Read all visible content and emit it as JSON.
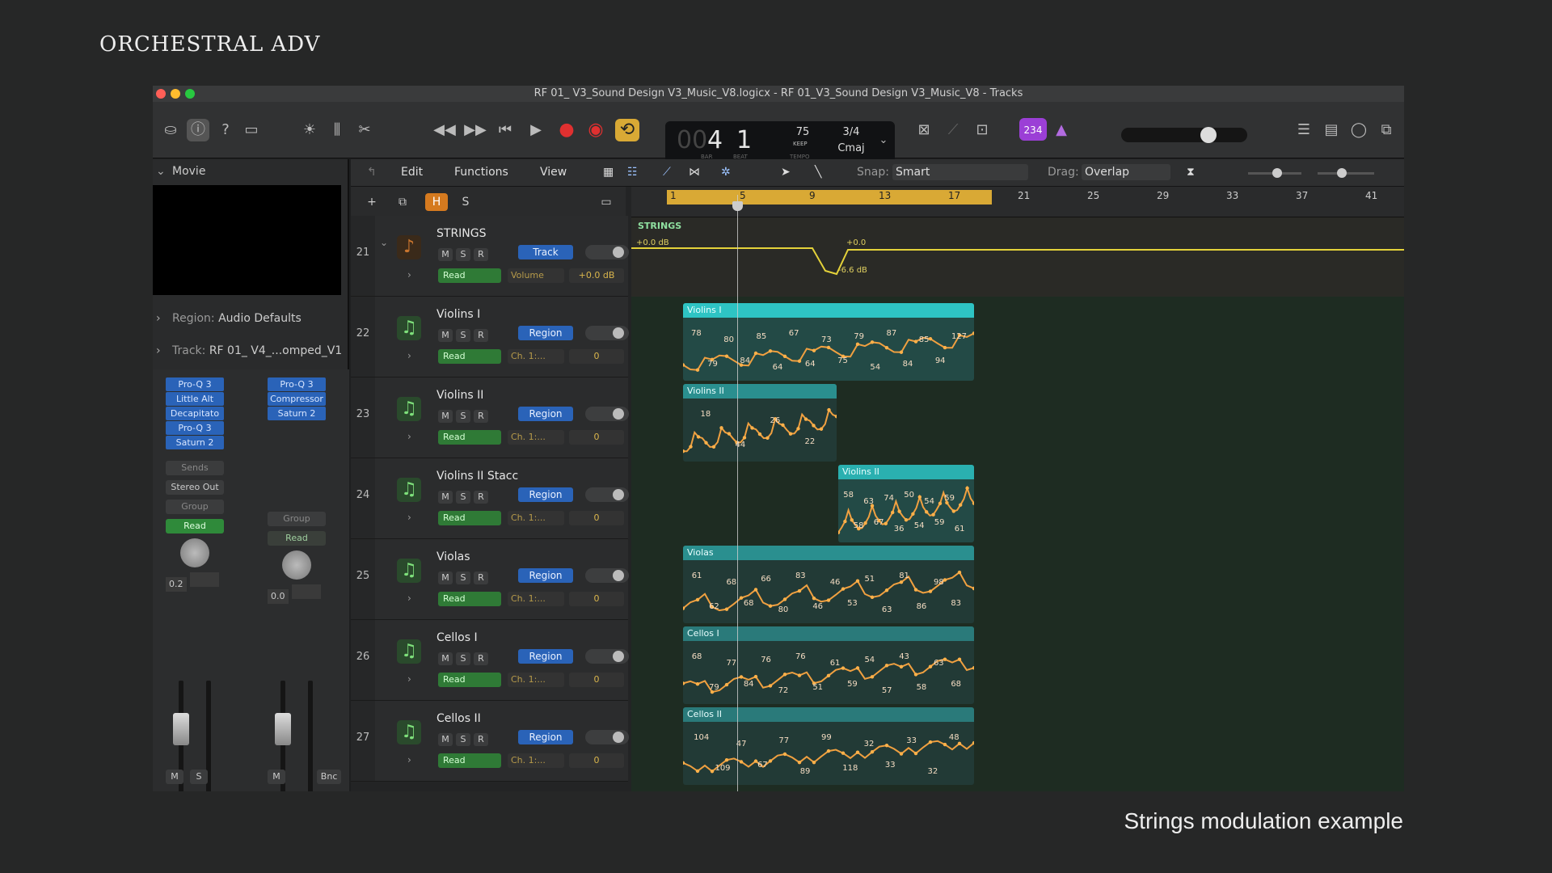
{
  "slide": {
    "title": "ORCHESTRAL ADV",
    "caption": "Strings modulation example"
  },
  "window": {
    "title": "RF 01_ V3_Sound Design V3_Music_V8.logicx - RF 01_V3_Sound Design V3_Music_V8 - Tracks"
  },
  "transport": {
    "bar": "4",
    "beat": "1",
    "bar_label": "BAR",
    "beat_label": "BEAT",
    "tempo": "75",
    "tempo_keep": "KEEP",
    "tempo_label": "TEMPO",
    "signature": "3/4",
    "key": "Cmaj",
    "count_in": "234",
    "accent_color": "#9b3fd6",
    "cycle_color": "#d9a935",
    "record_color": "#e03030"
  },
  "inspector": {
    "movie_label": "Movie",
    "region_label": "Region:",
    "region_value": "Audio Defaults",
    "track_label": "Track:",
    "track_value": "RF 01_ V4_...omped_V1",
    "strip1": {
      "plugins": [
        "Pro-Q 3",
        "Little Alt",
        "Decapitato",
        "Pro-Q 3",
        "Saturn 2"
      ],
      "sends": "Sends",
      "output": "Stereo Out",
      "group": "Group",
      "automation": "Read",
      "pan": "0.2",
      "m": "M",
      "s": "S"
    },
    "strip2": {
      "plugins": [
        "Pro-Q 3",
        "Compressor",
        "Saturn 2"
      ],
      "group": "Group",
      "automation": "Read",
      "pan": "0.0",
      "m": "M",
      "bnc": "Bnc"
    }
  },
  "edit_menu": {
    "edit": "Edit",
    "functions": "Functions",
    "view": "View",
    "snap_label": "Snap:",
    "snap_value": "Smart",
    "drag_label": "Drag:",
    "drag_value": "Overlap"
  },
  "header_buttons": {
    "plus": "+",
    "h": "H",
    "s": "S"
  },
  "tracks": [
    {
      "num": "21",
      "name": "STRINGS",
      "button": "Track",
      "automation": "Read",
      "param": "Volume",
      "value": "+0.0 dB"
    },
    {
      "num": "22",
      "name": "Violins I",
      "button": "Region",
      "automation": "Read",
      "param": "Ch. 1:...",
      "value": "0"
    },
    {
      "num": "23",
      "name": "Violins II",
      "button": "Region",
      "automation": "Read",
      "param": "Ch. 1:...",
      "value": "0"
    },
    {
      "num": "24",
      "name": "Violins II Stacc",
      "button": "Region",
      "automation": "Read",
      "param": "Ch. 1:...",
      "value": "0"
    },
    {
      "num": "25",
      "name": "Violas",
      "button": "Region",
      "automation": "Read",
      "param": "Ch. 1:...",
      "value": "0"
    },
    {
      "num": "26",
      "name": "Cellos I",
      "button": "Region",
      "automation": "Read",
      "param": "Ch. 1:...",
      "value": "0"
    },
    {
      "num": "27",
      "name": "Cellos II",
      "button": "Region",
      "automation": "Read",
      "param": "Ch. 1:...",
      "value": "0"
    }
  ],
  "ruler": {
    "bars": [
      "1",
      "5",
      "9",
      "13",
      "17",
      "21",
      "25",
      "29",
      "33",
      "37",
      "41"
    ]
  },
  "strings_lane": {
    "label": "STRINGS",
    "start": "+0.0 dB",
    "peak": "+0.0",
    "dip": "-6.6 dB"
  },
  "regions": [
    {
      "name": "Violins I",
      "values": [
        "78",
        "79",
        "80",
        "84",
        "85",
        "64",
        "67",
        "64",
        "73",
        "75",
        "79",
        "54",
        "87",
        "84",
        "85",
        "94",
        "127"
      ]
    },
    {
      "name": "Violins II",
      "values": [
        "18",
        "44",
        "26",
        "22"
      ]
    },
    {
      "name": "Violins II",
      "values": [
        "58",
        "58",
        "63",
        "67",
        "74",
        "36",
        "50",
        "54",
        "54",
        "59",
        "59",
        "61"
      ]
    },
    {
      "name": "Violas",
      "values": [
        "61",
        "62",
        "68",
        "68",
        "66",
        "80",
        "83",
        "46",
        "46",
        "53",
        "51",
        "63",
        "81",
        "86",
        "98",
        "83"
      ]
    },
    {
      "name": "Cellos I",
      "values": [
        "68",
        "79",
        "77",
        "84",
        "76",
        "72",
        "76",
        "51",
        "61",
        "59",
        "54",
        "57",
        "43",
        "58",
        "63",
        "68"
      ]
    },
    {
      "name": "Cellos II",
      "values": [
        "104",
        "109",
        "47",
        "67",
        "77",
        "89",
        "99",
        "118",
        "32",
        "33",
        "33",
        "32",
        "48"
      ]
    }
  ]
}
